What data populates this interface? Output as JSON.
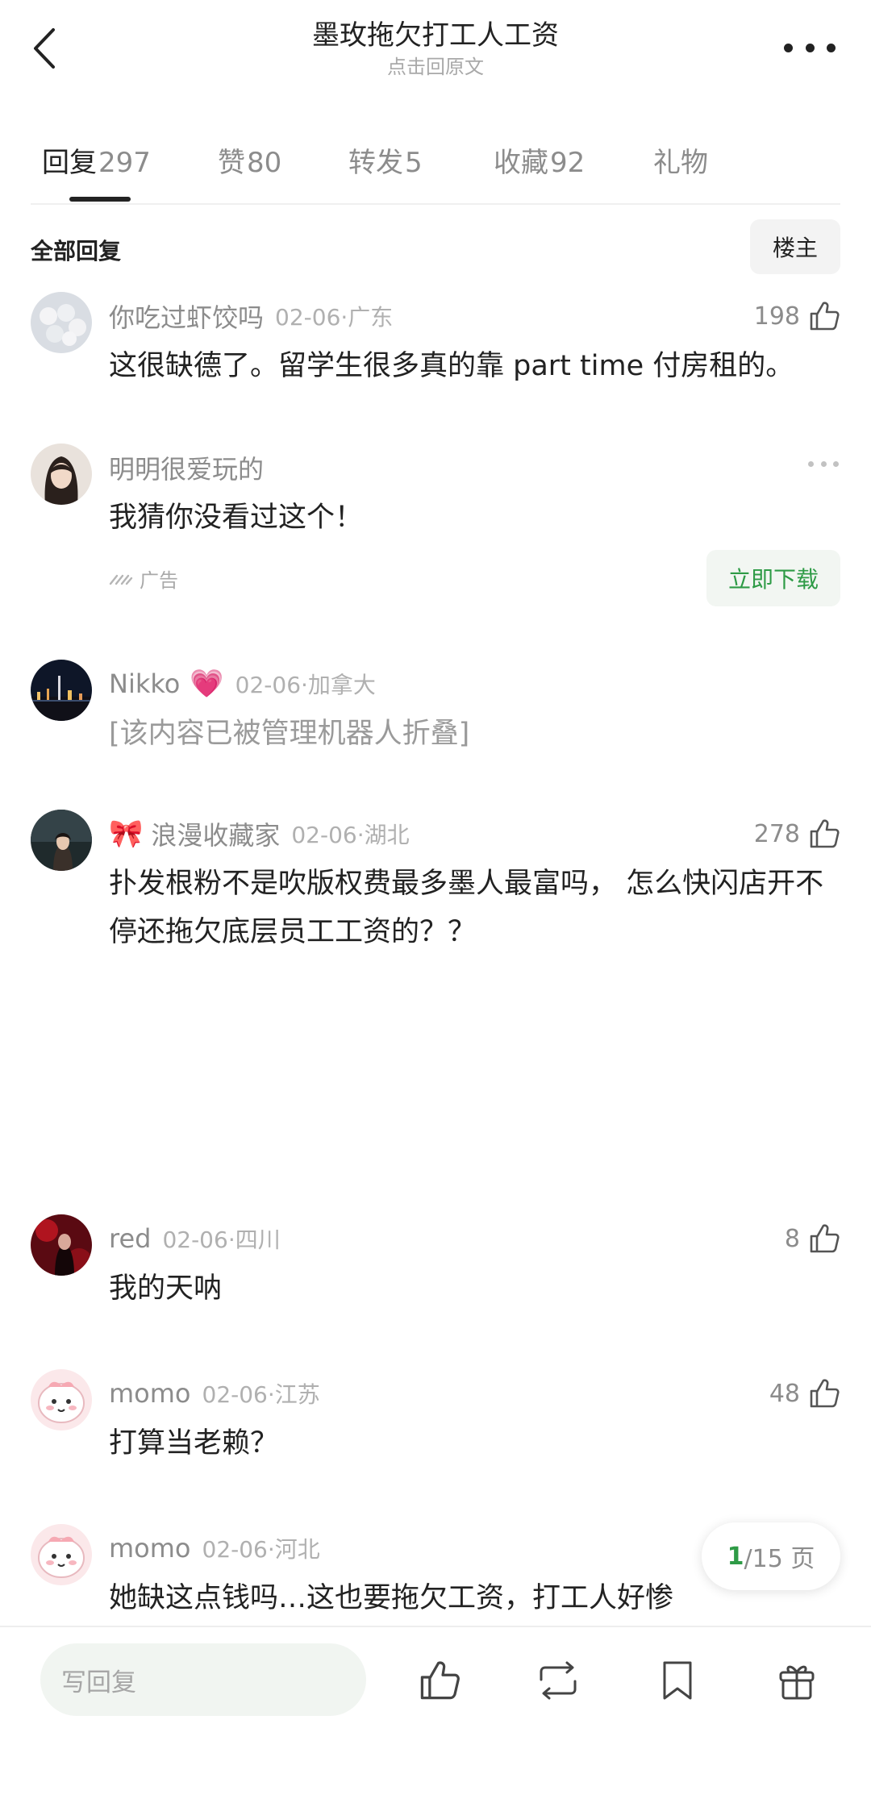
{
  "header": {
    "title": "墨玫拖欠打工人工资",
    "subtitle": "点击回原文"
  },
  "tabs": [
    {
      "label": "回复",
      "count": "297",
      "active": true
    },
    {
      "label": "赞",
      "count": "80"
    },
    {
      "label": "转发",
      "count": "5"
    },
    {
      "label": "收藏",
      "count": "92"
    },
    {
      "label": "礼物",
      "count": ""
    }
  ],
  "section": {
    "title": "全部回复",
    "owner_button": "楼主"
  },
  "comments": [
    {
      "user": "你吃过虾饺吗",
      "date": "02-06·广东",
      "likes": "198",
      "text": "这很缺德了。留学生很多真的靠 part time 付房租的。"
    },
    {
      "user": "明明很爱玩的",
      "text": "我猜你没看过这个！",
      "ad_label": "广告",
      "ad_button": "立即下载"
    },
    {
      "user": "Nikko",
      "emoji": "💗",
      "date": "02-06·加拿大",
      "text": "[该内容已被管理机器人折叠]"
    },
    {
      "user": "浪漫收藏家",
      "emoji": "🎀",
      "date": "02-06·湖北",
      "likes": "278",
      "text": "扑发根粉不是吹版权费最多墨人最富吗， 怎么快闪店开不停还拖欠底层员工工资的？？"
    },
    {
      "user": "red",
      "date": "02-06·四川",
      "likes": "8",
      "text": "我的天呐"
    },
    {
      "user": "momo",
      "date": "02-06·江苏",
      "likes": "48",
      "text": "打算当老赖？"
    },
    {
      "user": "momo",
      "date": "02-06·河北",
      "text": "她缺这点钱吗…这也要拖欠工资，打工人好惨"
    }
  ],
  "pagination": {
    "current": "1",
    "total_text": "/15 页"
  },
  "bottom_bar": {
    "reply_placeholder": "写回复"
  },
  "colors": {
    "accent_green": "#2e9b46",
    "muted": "#8c8c8c"
  }
}
